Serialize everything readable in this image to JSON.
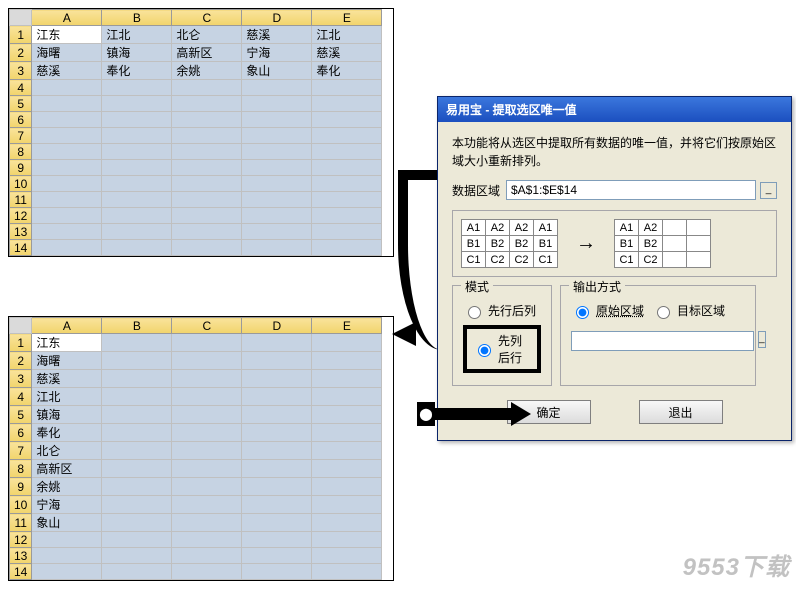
{
  "columns": [
    "A",
    "B",
    "C",
    "D",
    "E"
  ],
  "grid1_rows": 14,
  "grid1_data": {
    "1": [
      "江东",
      "江北",
      "北仑",
      "慈溪",
      "江北"
    ],
    "2": [
      "海曙",
      "镇海",
      "高新区",
      "宁海",
      "慈溪"
    ],
    "3": [
      "慈溪",
      "奉化",
      "余姚",
      "象山",
      "奉化"
    ]
  },
  "grid2_rows": 14,
  "grid2_data": {
    "1": [
      "江东",
      "",
      "",
      "",
      ""
    ],
    "2": [
      "海曙",
      "",
      "",
      "",
      ""
    ],
    "3": [
      "慈溪",
      "",
      "",
      "",
      ""
    ],
    "4": [
      "江北",
      "",
      "",
      "",
      ""
    ],
    "5": [
      "镇海",
      "",
      "",
      "",
      ""
    ],
    "6": [
      "奉化",
      "",
      "",
      "",
      ""
    ],
    "7": [
      "北仑",
      "",
      "",
      "",
      ""
    ],
    "8": [
      "高新区",
      "",
      "",
      "",
      ""
    ],
    "9": [
      "余姚",
      "",
      "",
      "",
      ""
    ],
    "10": [
      "宁海",
      "",
      "",
      "",
      ""
    ],
    "11": [
      "象山",
      "",
      "",
      "",
      ""
    ]
  },
  "dialog": {
    "title": "易用宝 - 提取选区唯一值",
    "desc": "本功能将从选区中提取所有数据的唯一值，并将它们按原始区域大小重新排列。",
    "range_label": "数据区域",
    "range_value": "$A$1:$E$14",
    "example_left": [
      [
        "A1",
        "A2",
        "A2",
        "A1"
      ],
      [
        "B1",
        "B2",
        "B2",
        "B1"
      ],
      [
        "C1",
        "C2",
        "C2",
        "C1"
      ]
    ],
    "example_right": [
      [
        "A1",
        "A2",
        "",
        ""
      ],
      [
        "B1",
        "B2",
        "",
        ""
      ],
      [
        "C1",
        "C2",
        "",
        ""
      ]
    ],
    "arrow": "→",
    "mode_legend": "模式",
    "mode_opt1": "先行后列",
    "mode_opt2": "先列后行",
    "output_legend": "输出方式",
    "output_opt1": "原始区域",
    "output_opt2": "目标区域",
    "btn_ok": "确定",
    "btn_exit": "退出"
  },
  "watermark": "9553下载"
}
